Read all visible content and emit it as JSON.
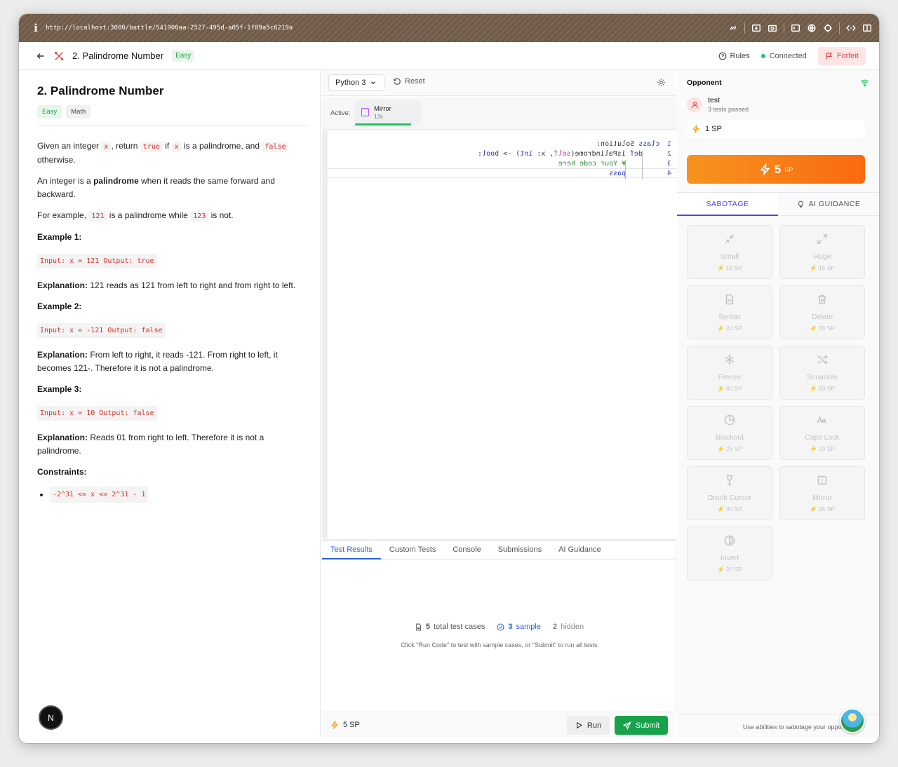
{
  "browser": {
    "url": "http://localhost:3000/battle/541900aa-2527-495d-a05f-1f89a5c6219a"
  },
  "header": {
    "title": "2. Palindrome Number",
    "difficulty": "Easy",
    "rules": "Rules",
    "connection_status": "Connected",
    "forfeit": "Forfeit"
  },
  "problem": {
    "title": "2. Palindrome Number",
    "tags": [
      "Easy",
      "Math"
    ],
    "intro_1": "Given an integer",
    "intro_x1": "x",
    "intro_2": ", return",
    "intro_true": "true",
    "intro_3": "if",
    "intro_x2": "x",
    "intro_4": "is a palindrome, and",
    "intro_false": "false",
    "intro_5": "otherwise.",
    "def_1": "An integer is a",
    "def_bold": "palindrome",
    "def_2": "when it reads the same forward and backward.",
    "ex_1": "For example,",
    "ex_121": "121",
    "ex_2": "is a palindrome while",
    "ex_123": "123",
    "ex_3": "is not.",
    "examples": [
      {
        "heading": "Example 1:",
        "code": "Input: x = 121 Output: true",
        "exp_label": "Explanation:",
        "exp_text": "121 reads as 121 from left to right and from right to left."
      },
      {
        "heading": "Example 2:",
        "code": "Input: x = -121 Output: false",
        "exp_label": "Explanation:",
        "exp_text": "From left to right, it reads -121. From right to left, it becomes 121-. Therefore it is not a palindrome."
      },
      {
        "heading": "Example 3:",
        "code": "Input: x = 10 Output: false",
        "exp_label": "Explanation:",
        "exp_text": "Reads 01 from right to left. Therefore it is not a palindrome."
      }
    ],
    "constraints_heading": "Constraints:",
    "constraints": [
      "-2^31 <= x <= 2^31 - 1"
    ]
  },
  "nextjs_badge": "N",
  "editor": {
    "language": "Python 3",
    "reset": "Reset",
    "active_label": "Active:",
    "active_effect": {
      "name": "Mirror",
      "time": "13s",
      "remaining_fraction": 0.85
    },
    "line_numbers": [
      "1",
      "2",
      "3",
      "4"
    ],
    "code": {
      "l1_kw": "class",
      "l1_rest": " Solution:",
      "l2_kw": "def",
      "l2_fn": " isPalindrome(",
      "l2_self": "self",
      "l2_mid": ", x: ",
      "l2_int": "int",
      "l2_arrow": ") -> ",
      "l2_bool": "bool",
      "l2_end": ":",
      "l3": "# Your code here",
      "l4": "pass"
    }
  },
  "results": {
    "tabs": [
      "Test Results",
      "Custom Tests",
      "Console",
      "Submissions",
      "AI Guidance"
    ],
    "total_count": "5",
    "total_label": "total test cases",
    "sample_count": "3",
    "sample_label": "sample",
    "hidden_count": "2",
    "hidden_label": "hidden",
    "hint": "Click \"Run Code\" to test with sample cases, or \"Submit\" to run all tests"
  },
  "footer": {
    "sp": "5 SP",
    "run": "Run",
    "submit": "Submit"
  },
  "opponent": {
    "heading": "Opponent",
    "name": "test",
    "tests": "3 tests passed",
    "sp": "1 SP"
  },
  "my_sp": {
    "value": "5",
    "unit": "SP"
  },
  "right_tabs": [
    "SABOTAGE",
    "AI GUIDANCE"
  ],
  "abilities": [
    {
      "name": "Small",
      "cost": "15 SP",
      "icon": "shrink-icon"
    },
    {
      "name": "Huge",
      "cost": "15 SP",
      "icon": "expand-icon"
    },
    {
      "name": "Syntax",
      "cost": "20 SP",
      "icon": "file-code-icon"
    },
    {
      "name": "Delete",
      "cost": "30 SP",
      "icon": "trash-icon"
    },
    {
      "name": "Freeze",
      "cost": "40 SP",
      "icon": "snowflake-icon"
    },
    {
      "name": "Scramble",
      "cost": "50 SP",
      "icon": "shuffle-icon"
    },
    {
      "name": "Blackout",
      "cost": "25 SP",
      "icon": "pie-chart-icon"
    },
    {
      "name": "Caps Lock",
      "cost": "20 SP",
      "icon": "case-sensitive-icon"
    },
    {
      "name": "Drunk Cursor",
      "cost": "30 SP",
      "icon": "wine-icon"
    },
    {
      "name": "Mirror",
      "cost": "25 SP",
      "icon": "flip-icon"
    },
    {
      "name": "Invert",
      "cost": "20 SP",
      "icon": "contrast-icon"
    }
  ],
  "right_footer": "Use abilities to sabotage your opponent",
  "colors": {
    "accent": "#4f46e5",
    "success": "#16a34a",
    "sp_gradient_start": "#f7931e",
    "sp_gradient_end": "#f96a10",
    "danger": "#e5484d"
  }
}
